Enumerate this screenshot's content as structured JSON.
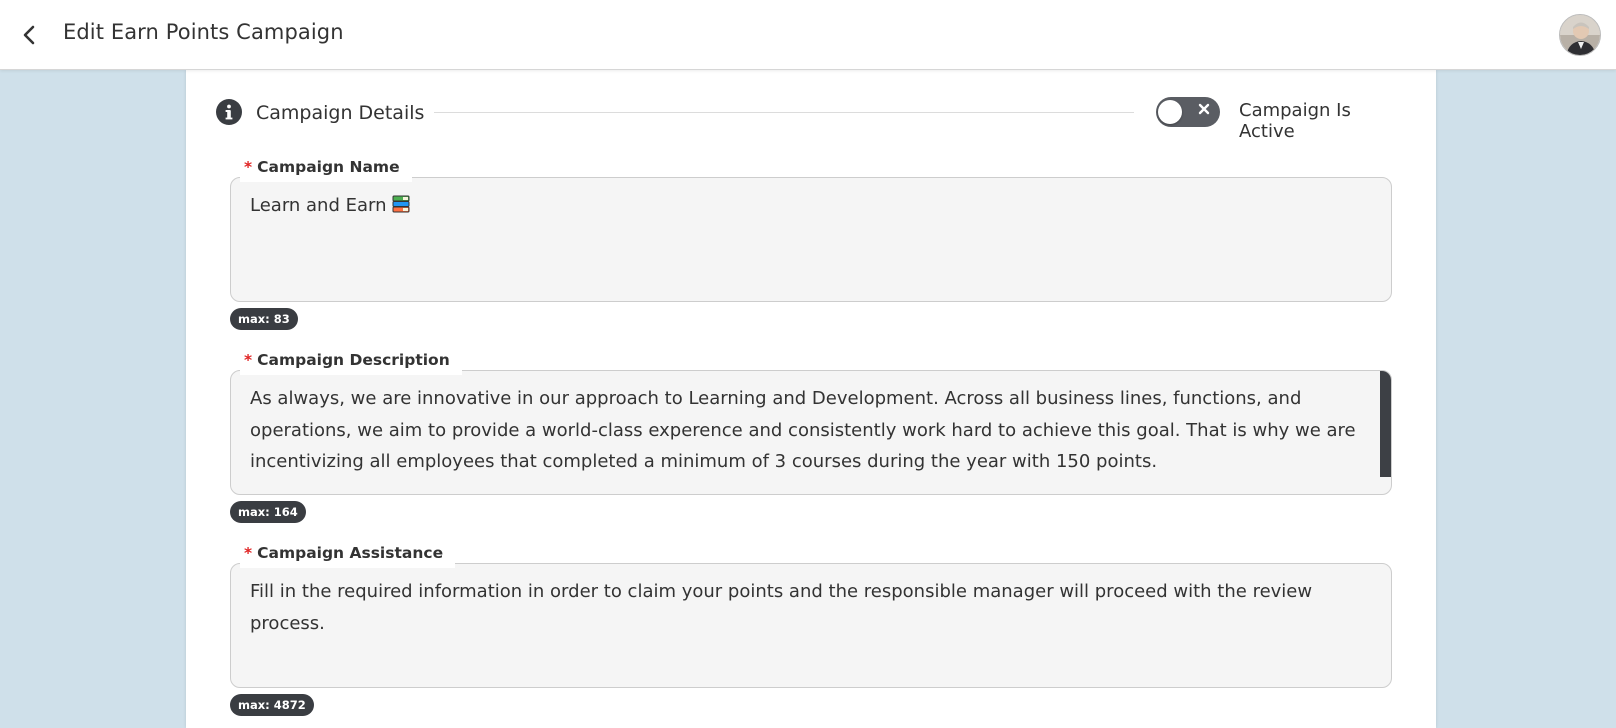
{
  "header": {
    "title": "Edit Earn Points Campaign"
  },
  "section": {
    "title": "Campaign Details",
    "toggle_label": "Campaign Is Active",
    "toggle_on": false
  },
  "fields": [
    {
      "label": "Campaign Name",
      "required_mark": "*",
      "value": "Learn and Earn",
      "max_label": "max: 83"
    },
    {
      "label": "Campaign Description",
      "required_mark": "*",
      "value": "As always, we are innovative in our approach to Learning and Development. Across all business lines, functions, and operations, we aim to provide a world-class experence and consistently work hard to achieve this goal. That is why we are incentivizing all employees that completed a minimum of 3 courses during the year with 150 points.",
      "max_label": "max: 164"
    },
    {
      "label": "Campaign Assistance",
      "required_mark": "*",
      "value": "Fill in the required information in order to claim your points and the responsible manager will proceed with the review process.",
      "max_label": "max: 4872"
    }
  ],
  "colors": {
    "background": "#cfe0ea",
    "required": "#e02424",
    "badge": "#3a3d42"
  }
}
